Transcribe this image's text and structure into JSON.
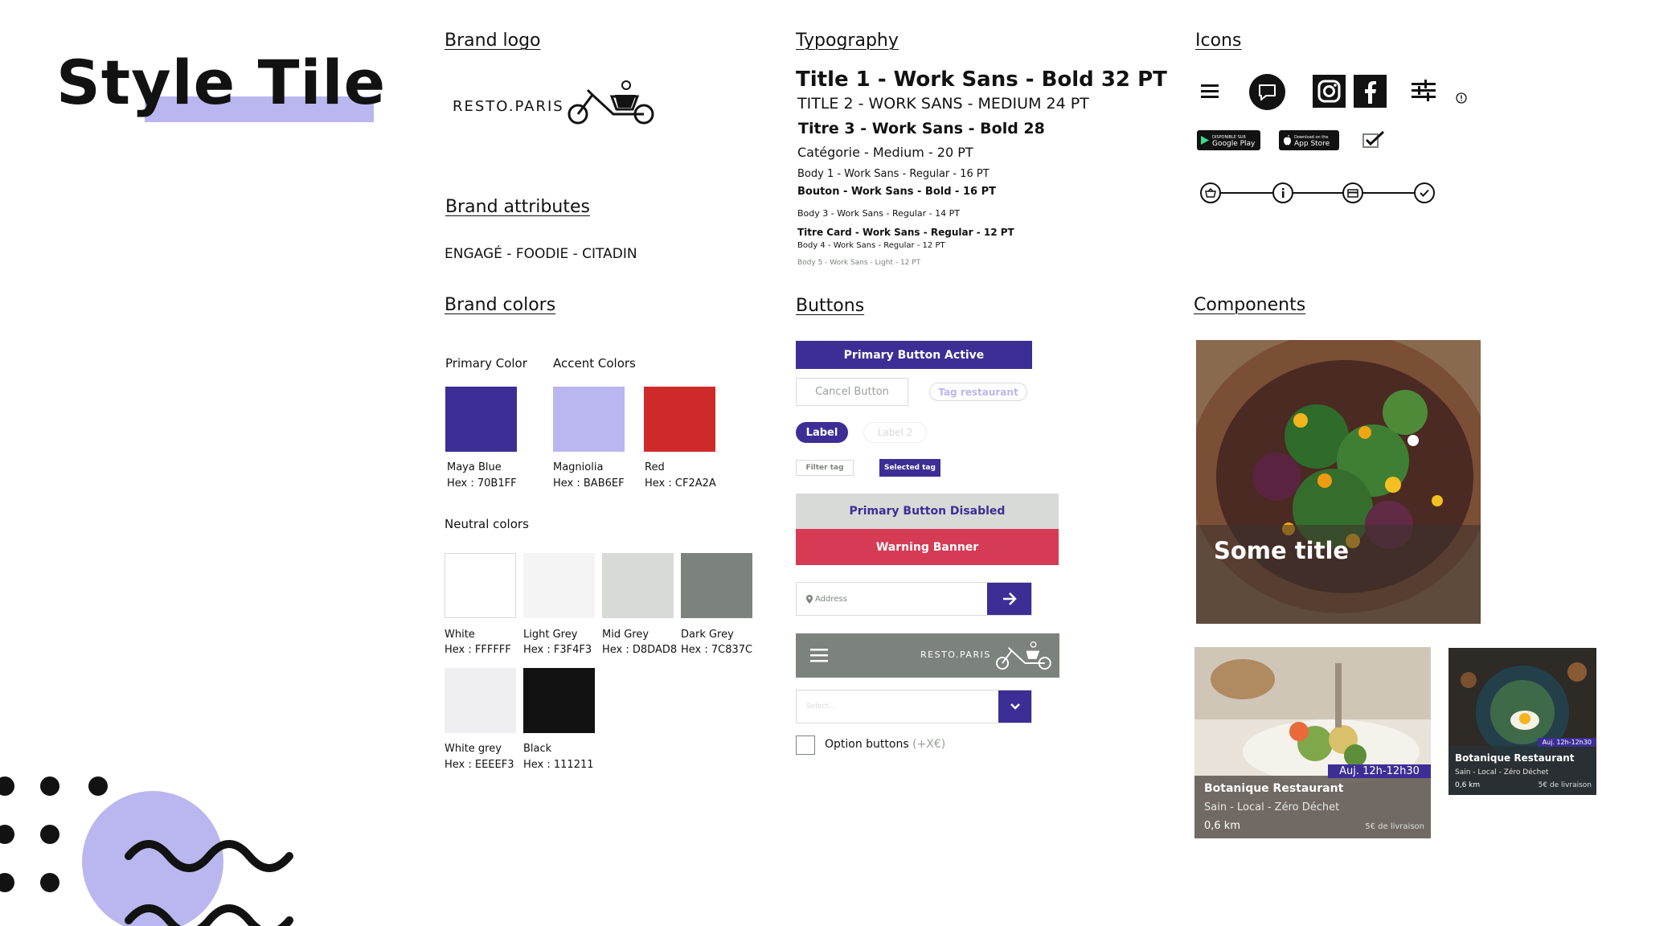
{
  "page_title": "Style Tile",
  "brand_logo": {
    "heading": "Brand logo",
    "text": "RESTO.PARIS"
  },
  "brand_attributes": {
    "heading": "Brand attributes",
    "text": "ENGAGÉ - FOODIE - CITADIN"
  },
  "brand_colors": {
    "heading": "Brand colors",
    "primary_label": "Primary Color",
    "accent_label": "Accent Colors",
    "neutral_label": "Neutral colors",
    "primary": [
      {
        "name": "Maya Blue",
        "hex_label": "Hex : 70B1FF",
        "color": "#3d2e96"
      }
    ],
    "accent": [
      {
        "name": "Magniolia",
        "hex_label": "Hex : BAB6EF",
        "color": "#bab6ef"
      },
      {
        "name": "Red",
        "hex_label": "Hex : CF2A2A",
        "color": "#cf2a2a"
      }
    ],
    "neutral": [
      {
        "name": "White",
        "hex_label": "Hex : FFFFFF",
        "color": "#ffffff"
      },
      {
        "name": "Light Grey",
        "hex_label": "Hex : F3F4F3",
        "color": "#f3f4f3"
      },
      {
        "name": "Mid Grey",
        "hex_label": "Hex : D8DAD8",
        "color": "#d8dad8"
      },
      {
        "name": "Dark Grey",
        "hex_label": "Hex : 7C837C",
        "color": "#7c837c"
      },
      {
        "name": "White grey",
        "hex_label": "Hex : EEEEF3",
        "color": "#eeeef3"
      },
      {
        "name": "Black",
        "hex_label": "Hex : 111211",
        "color": "#111211"
      }
    ]
  },
  "typography": {
    "heading": "Typography",
    "samples": [
      "Title 1 - Work Sans - Bold 32 PT",
      "TITLE 2 - WORK SANS - MEDIUM 24 PT",
      "Titre 3 - Work Sans - Bold 28",
      "Catégorie - Medium - 20 PT",
      "Body 1 - Work Sans - Regular - 16 PT",
      "Bouton - Work Sans - Bold - 16 PT",
      "Body 3 - Work Sans - Regular - 14 PT",
      "Titre Card - Work Sans - Regular - 12 PT",
      "Body 4 - Work Sans - Regular - 12 PT",
      "Body 5 - Work Sans - Light - 12 PT"
    ]
  },
  "icons": {
    "heading": "Icons",
    "google_play_small": "DISPONIBLE SUR",
    "google_play": "Google Play",
    "app_store_small": "Download on the",
    "app_store": "App Store",
    "names": [
      "menu-icon",
      "chat-icon",
      "instagram-icon",
      "facebook-icon",
      "filter-sliders-icon",
      "info-small-icon",
      "check-box-icon",
      "basket-step-icon",
      "info-step-icon",
      "card-step-icon",
      "check-step-icon"
    ]
  },
  "buttons": {
    "heading": "Buttons",
    "primary_active": "Primary Button Active",
    "cancel": "Cancel Button",
    "tag_restaurant": "Tag restaurant",
    "label": "Label",
    "label2": "Label 2",
    "filter_tag": "Filter tag",
    "selected_tag": "Selected tag",
    "primary_disabled": "Primary Button Disabled",
    "warning_banner": "Warning Banner",
    "address_placeholder": "Address",
    "header_logo": "RESTO.PARIS",
    "select_placeholder": "Select...",
    "option_label": "Option buttons",
    "option_price": "(+X€)"
  },
  "components": {
    "heading": "Components",
    "hero_title": "Some title",
    "card_large": {
      "badge": "Auj. 12h-12h30",
      "title": "Botanique Restaurant",
      "tags": "Sain - Local - Zéro Déchet",
      "distance": "0,6 km",
      "delivery": "5€ de livraison"
    },
    "card_small": {
      "badge": "Auj. 12h-12h30",
      "title": "Botanique Restaurant",
      "tags": "Sain - Local - Zéro Déchet",
      "distance": "0,6 km",
      "delivery": "5€ de livraison"
    }
  }
}
